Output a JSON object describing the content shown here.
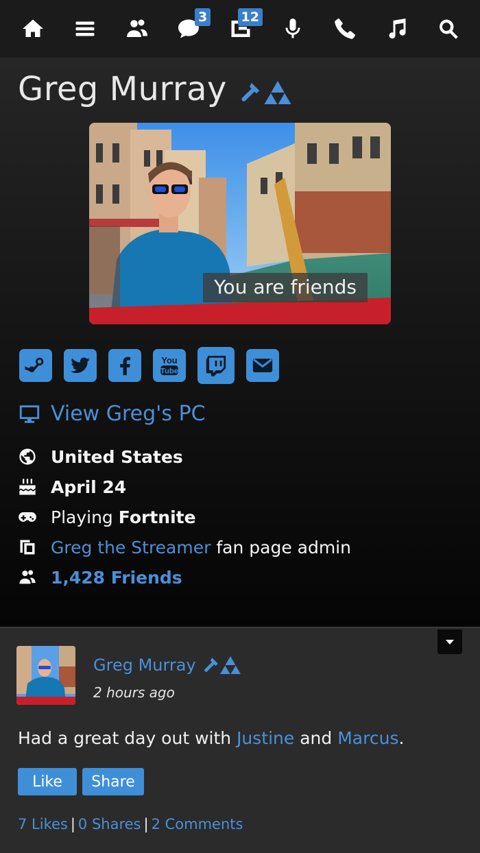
{
  "nav": {
    "items": [
      {
        "icon": "home-icon"
      },
      {
        "icon": "menu-icon"
      },
      {
        "icon": "friends-icon"
      },
      {
        "icon": "chat-icon",
        "badge": "3"
      },
      {
        "icon": "pages-icon",
        "badge": "12"
      },
      {
        "icon": "microphone-icon"
      },
      {
        "icon": "phone-icon"
      },
      {
        "icon": "music-icon"
      },
      {
        "icon": "search-icon"
      }
    ]
  },
  "profile": {
    "name": "Greg Murray",
    "badges": [
      "hammer-icon",
      "triforce-icon"
    ],
    "photo_label": "You are friends",
    "social": [
      "steam-icon",
      "twitter-icon",
      "facebook-icon",
      "youtube-icon",
      "twitch-icon",
      "email-icon"
    ],
    "view_pc": "View Greg's PC",
    "country": "United States",
    "birthday": "April 24",
    "playing_prefix": "Playing",
    "playing_game": "Fortnite",
    "page_link": "Greg the Streamer",
    "page_role": "fan page admin",
    "friends_count": "1,428 Friends"
  },
  "post": {
    "author": "Greg Murray",
    "time": "2 hours ago",
    "text_start": "Had a great day out with",
    "mention1": "Justine",
    "text_and": "and",
    "mention2": "Marcus",
    "text_end": ".",
    "like_label": "Like",
    "share_label": "Share",
    "likes": "7 Likes",
    "sep": "|",
    "shares": "0 Shares",
    "comments": "2 Comments"
  },
  "colors": {
    "accent": "#4a90d9",
    "button": "#3f8fd8",
    "nav_bg": "#1b1b1b",
    "post_bg": "#2b2b2b"
  }
}
